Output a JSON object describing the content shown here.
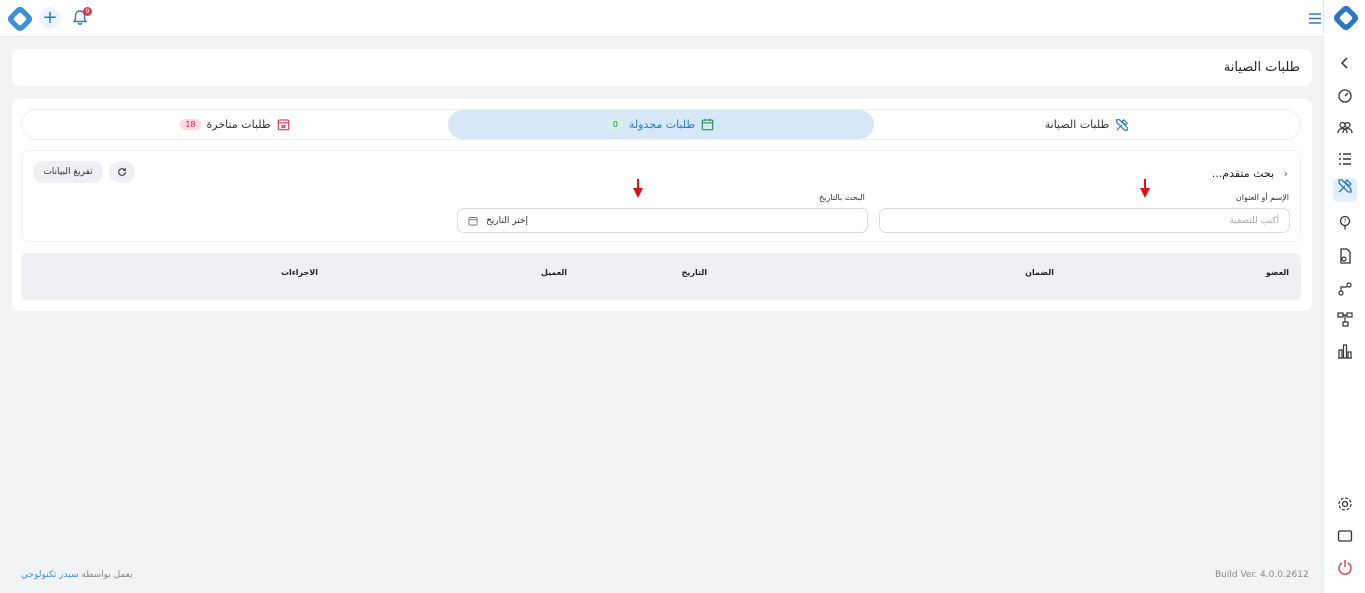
{
  "topbar": {
    "notification_count": "9",
    "add_label": "+"
  },
  "page": {
    "title": "طلبات الصيانة"
  },
  "tabs": [
    {
      "label": "طلبات الصيانة",
      "icon": "tools-icon",
      "count": ""
    },
    {
      "label": "طلبات مجدولة",
      "icon": "calendar-icon",
      "count": "0"
    },
    {
      "label": "طلبات متاخرة",
      "icon": "calendar-x-icon",
      "count": "18"
    }
  ],
  "filters": {
    "advanced_search_label": "بحث متقدم...",
    "name_label": "الإسم أو العنوان",
    "name_placeholder": "أكتب للتصفية",
    "date_label": "البحث بالتاريخ",
    "date_placeholder": "إختر التاريخ",
    "clear_label": "تفريغ البيانات"
  },
  "table": {
    "columns": [
      "العضو",
      "الضمان",
      "التاريخ",
      "العميل",
      "الاجراءات"
    ]
  },
  "footer": {
    "powered_prefix": "يعمل بواسطة",
    "powered_link": "سيدر تكنولوجي",
    "build": "Build Ver. 4.0.0.2612"
  },
  "colors": {
    "accent": "#2a78c5",
    "danger": "#e01010"
  }
}
